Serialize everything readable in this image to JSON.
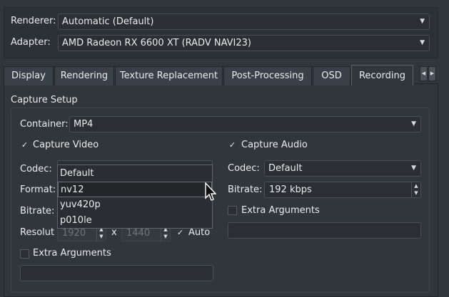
{
  "renderer": {
    "label": "Renderer:",
    "value": "Automatic (Default)"
  },
  "adapter": {
    "label": "Adapter:",
    "value": "AMD Radeon RX 6600 XT (RADV NAVI23)"
  },
  "tabs": [
    {
      "label": "Display"
    },
    {
      "label": "Rendering"
    },
    {
      "label": "Texture Replacement"
    },
    {
      "label": "Post-Processing"
    },
    {
      "label": "OSD"
    },
    {
      "label": "Recording"
    }
  ],
  "capture_setup": {
    "title": "Capture Setup",
    "container_label": "Container:",
    "container_value": "MP4",
    "capture_video": {
      "label": "Capture Video",
      "checked": true
    },
    "video": {
      "codec_label": "Codec:",
      "codec_value": "Default",
      "format_label": "Format:",
      "bitrate_label": "Bitrate:",
      "resolution_label": "Resolut",
      "width": "1920",
      "x_label": "x",
      "height": "1440",
      "auto_label": "Auto",
      "extra_args_label": "Extra Arguments"
    },
    "format_dropdown": {
      "items": [
        "Default",
        "nv12",
        "yuv420p",
        "p010le"
      ],
      "selected": "nv12"
    },
    "capture_audio": {
      "label": "Capture Audio",
      "checked": true
    },
    "audio": {
      "codec_label": "Codec:",
      "codec_value": "Default",
      "bitrate_label": "Bitrate:",
      "bitrate_value": "192 kbps",
      "extra_args_label": "Extra Arguments"
    }
  }
}
